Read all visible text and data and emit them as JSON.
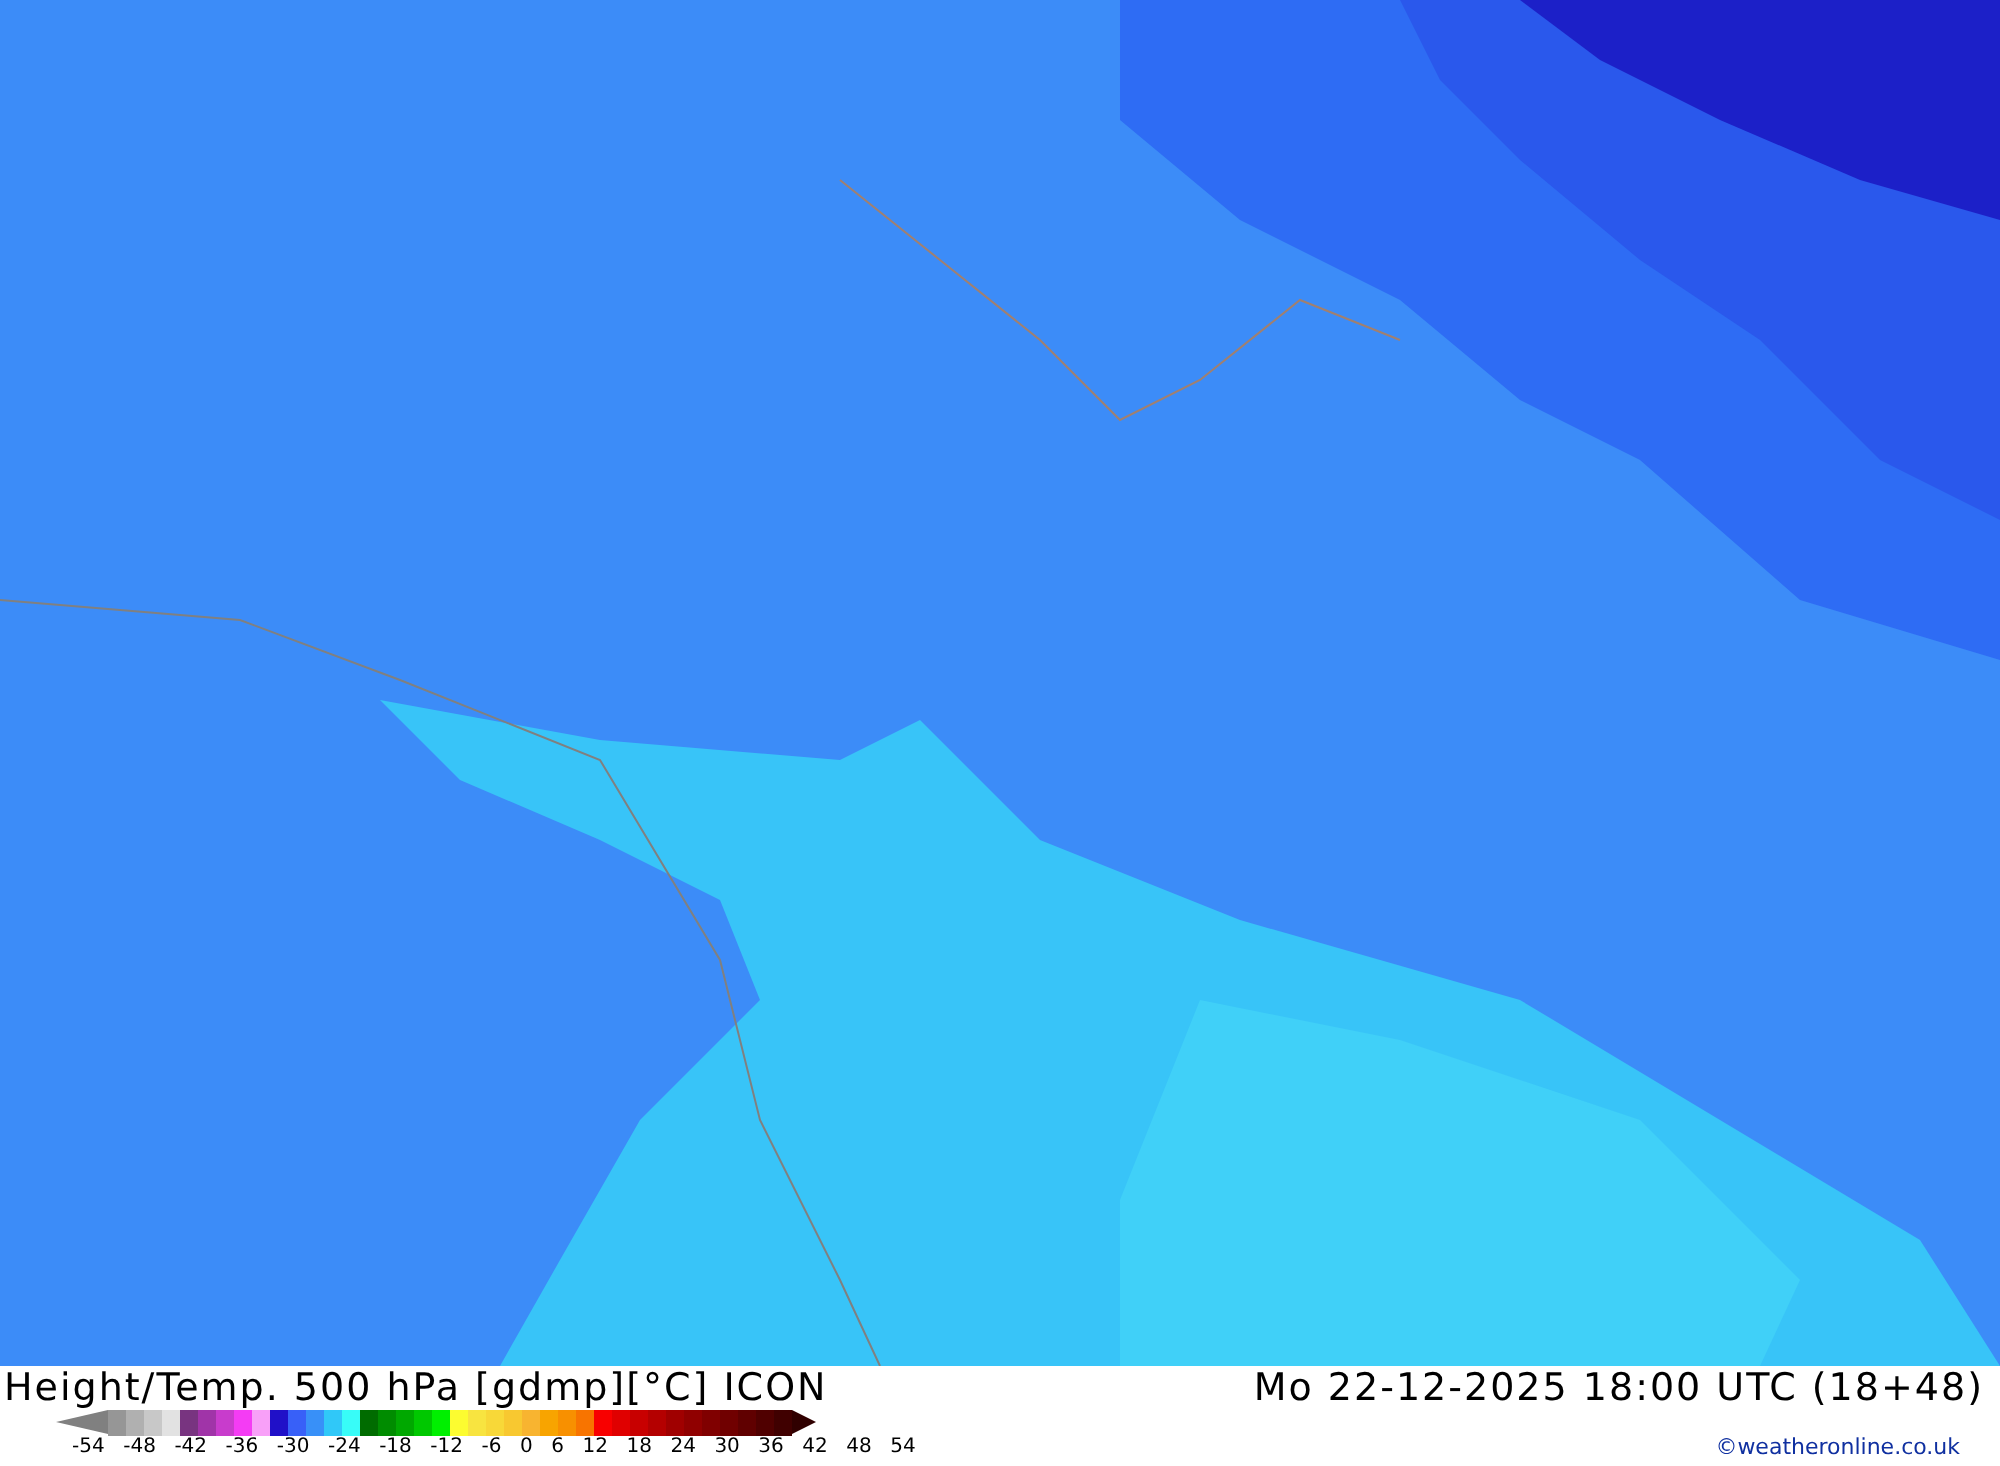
{
  "title": "Height/Temp. 500 hPa [gdmp][°C] ICON",
  "valid_time": "Mo 22-12-2025 18:00 UTC (18+48)",
  "legend": {
    "swatches": [
      {
        "color": "#808080",
        "kind": "arrow"
      },
      {
        "color": "#969696"
      },
      {
        "color": "#b0b0b0"
      },
      {
        "color": "#c8c8c8"
      },
      {
        "color": "#e2e2e2"
      },
      {
        "color": "#783480"
      },
      {
        "color": "#a034a8"
      },
      {
        "color": "#c83ccc"
      },
      {
        "color": "#f43cf4"
      },
      {
        "color": "#f8a0f8"
      },
      {
        "color": "#2010c8"
      },
      {
        "color": "#3860f8"
      },
      {
        "color": "#3890f8"
      },
      {
        "color": "#30c8f8"
      },
      {
        "color": "#38fcf8"
      },
      {
        "color": "#006c00"
      },
      {
        "color": "#008c00"
      },
      {
        "color": "#00a800"
      },
      {
        "color": "#00c800"
      },
      {
        "color": "#00f000"
      },
      {
        "color": "#fcfc30"
      },
      {
        "color": "#f8e440"
      },
      {
        "color": "#f8d838"
      },
      {
        "color": "#f8c830"
      },
      {
        "color": "#f8b430"
      },
      {
        "color": "#f8a400"
      },
      {
        "color": "#f89000"
      },
      {
        "color": "#f87400"
      },
      {
        "color": "#f80000"
      },
      {
        "color": "#e00000"
      },
      {
        "color": "#c80000"
      },
      {
        "color": "#b40000"
      },
      {
        "color": "#a00000"
      },
      {
        "color": "#900000"
      },
      {
        "color": "#800000"
      },
      {
        "color": "#700000"
      },
      {
        "color": "#600000"
      },
      {
        "color": "#500000"
      },
      {
        "color": "#400000"
      },
      {
        "color": "#300000",
        "kind": "arrow"
      }
    ],
    "labels": [
      "-54",
      "-48",
      "-42",
      "-36",
      "-30",
      "-24",
      "-18",
      "-12",
      "-6",
      "0",
      "6",
      "12",
      "18",
      "24",
      "30",
      "36",
      "42",
      "48",
      "54"
    ]
  },
  "credit": "©weatheronline.co.uk"
}
